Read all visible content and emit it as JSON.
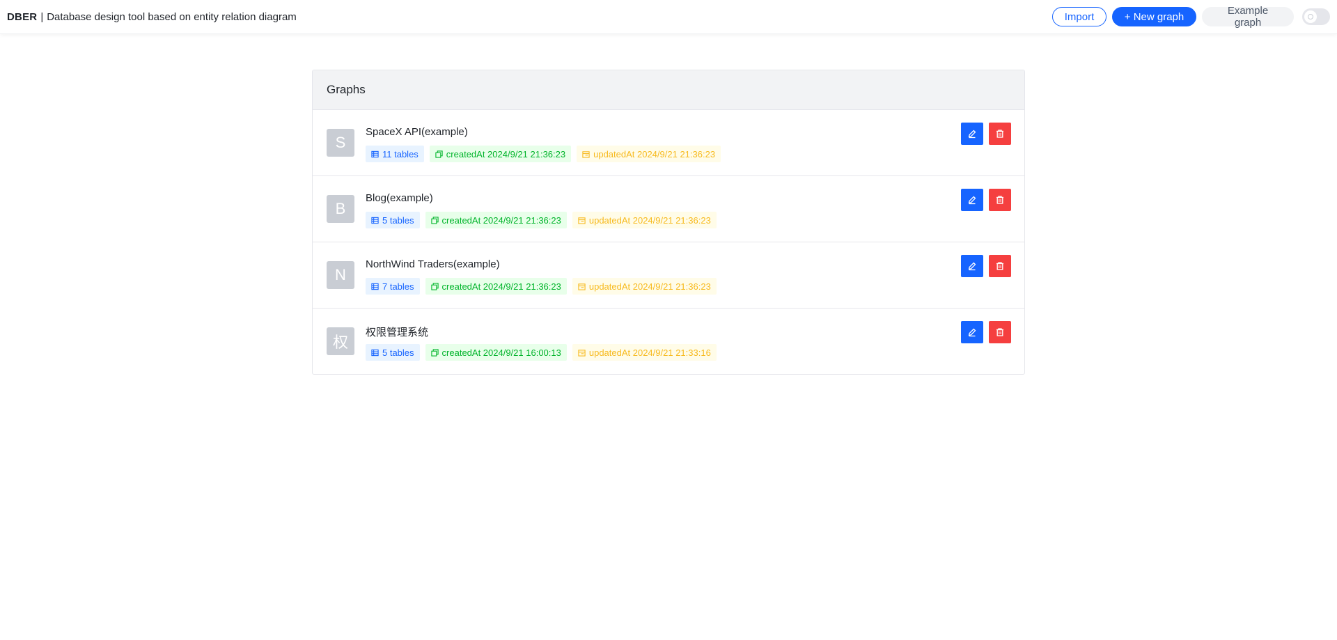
{
  "header": {
    "brand": "DBER",
    "separator": "|",
    "tagline": "Database design tool based on entity relation diagram",
    "import_label": "Import",
    "new_graph_label": "+ New graph",
    "example_graph_label": "Example graph",
    "theme_toggle": {
      "checked": false
    }
  },
  "graphs": {
    "title": "Graphs",
    "items": [
      {
        "initial": "S",
        "name": "SpaceX API(example)",
        "tables": "11 tables",
        "created": "createdAt 2024/9/21 21:36:23",
        "updated": "updatedAt 2024/9/21 21:36:23"
      },
      {
        "initial": "B",
        "name": "Blog(example)",
        "tables": "5 tables",
        "created": "createdAt 2024/9/21 21:36:23",
        "updated": "updatedAt 2024/9/21 21:36:23"
      },
      {
        "initial": "N",
        "name": "NorthWind Traders(example)",
        "tables": "7 tables",
        "created": "createdAt 2024/9/21 21:36:23",
        "updated": "updatedAt 2024/9/21 21:36:23"
      },
      {
        "initial": "权",
        "name": "权限管理系统",
        "tables": "5 tables",
        "created": "createdAt 2024/9/21 16:00:13",
        "updated": "updatedAt 2024/9/21 21:33:16"
      }
    ]
  },
  "colors": {
    "primary": "#1664ff",
    "danger": "#f53f3f",
    "tag_blue": "#1664ff",
    "tag_green": "#00b42a",
    "tag_yellow": "#f7ba1e"
  }
}
